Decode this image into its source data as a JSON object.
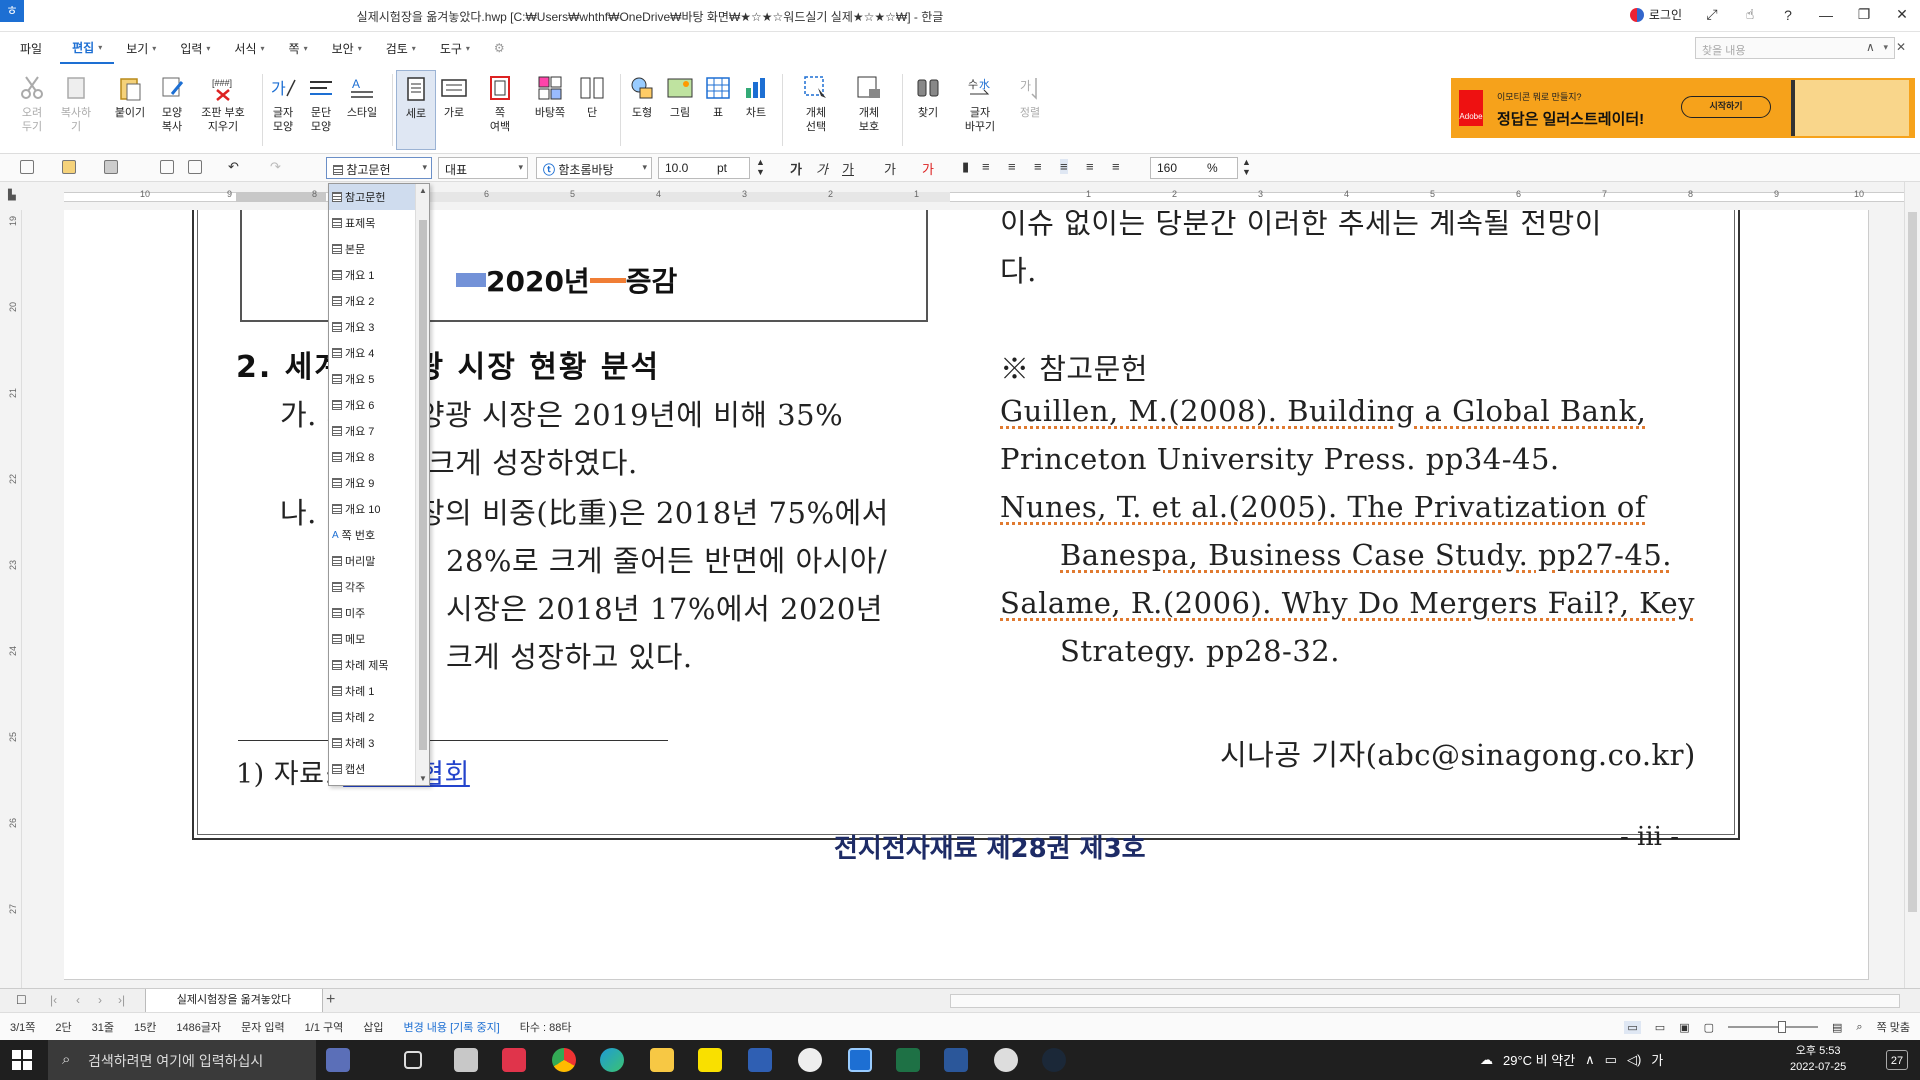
{
  "window": {
    "title": "실제시험장을 옮겨놓았다.hwp [C:₩Users₩whthf₩OneDrive₩바탕 화면₩★☆★☆워드실기 실제★☆★☆₩] - 한글",
    "login_label": "로그인"
  },
  "menu": {
    "items": [
      "파일",
      "편집",
      "보기",
      "입력",
      "서식",
      "쪽",
      "보안",
      "검토",
      "도구"
    ],
    "active": "편집",
    "search_placeholder": "찾을 내용"
  },
  "ribbon": {
    "buttons": [
      {
        "label": "오려\n두기",
        "icon": "scissors-icon"
      },
      {
        "label": "복사하기",
        "icon": "copy-icon"
      },
      {
        "label": "붙이기",
        "icon": "paste-icon"
      },
      {
        "label": "모양\n복사",
        "icon": "format-painter-icon"
      },
      {
        "label": "조판 부호\n지우기",
        "icon": "clear-codes-icon"
      },
      {
        "label": "글자\n모양",
        "icon": "char-shape-icon"
      },
      {
        "label": "문단\n모양",
        "icon": "para-shape-icon"
      },
      {
        "label": "스타일",
        "icon": "style-icon"
      },
      {
        "label": "세로",
        "icon": "portrait-icon"
      },
      {
        "label": "가로",
        "icon": "landscape-icon"
      },
      {
        "label": "쪽\n여백",
        "icon": "page-margin-icon"
      },
      {
        "label": "바탕쪽",
        "icon": "master-page-icon"
      },
      {
        "label": "단",
        "icon": "columns-icon"
      },
      {
        "label": "도형",
        "icon": "shape-icon"
      },
      {
        "label": "그림",
        "icon": "picture-icon"
      },
      {
        "label": "표",
        "icon": "table-icon"
      },
      {
        "label": "차트",
        "icon": "chart-icon"
      },
      {
        "label": "개체\n선택",
        "icon": "select-object-icon"
      },
      {
        "label": "개체\n보호",
        "icon": "protect-object-icon"
      },
      {
        "label": "찾기",
        "icon": "binoculars-icon"
      },
      {
        "label": "글자\n바꾸기",
        "icon": "char-convert-icon"
      },
      {
        "label": "정렬",
        "icon": "sort-icon"
      }
    ],
    "ad": {
      "brand": "Adobe",
      "small_text": "이모티콘 뭐로 만들지?",
      "headline": "정답은 일러스트레이터!",
      "button": "시작하기"
    }
  },
  "format_bar": {
    "style": "참고문헌",
    "font_lang": "대표",
    "font_name": "함초롬바탕",
    "font_size": "10.0",
    "font_unit": "pt",
    "line_spacing": "160",
    "line_unit": "%"
  },
  "style_dropdown": {
    "items": [
      "참고문헌",
      "표제목",
      "본문",
      "개요 1",
      "개요 2",
      "개요 3",
      "개요 4",
      "개요 5",
      "개요 6",
      "개요 7",
      "개요 8",
      "개요 9",
      "개요 10",
      "쪽 번호",
      "머리말",
      "각주",
      "미주",
      "메모",
      "차례 제목",
      "차례 1",
      "차례 2",
      "차례 3",
      "캡션"
    ],
    "selected_index": 0
  },
  "ruler": {
    "top_numbers": [
      "10",
      "9",
      "8",
      "7",
      "6",
      "5",
      "4",
      "3",
      "2",
      "1",
      "1",
      "2",
      "3",
      "4",
      "5",
      "6",
      "7",
      "8",
      "9",
      "10"
    ],
    "left_numbers": [
      "19",
      "20",
      "21",
      "22",
      "23",
      "24",
      "25",
      "26",
      "27"
    ]
  },
  "document": {
    "chart_legend": {
      "series_1": "2020년",
      "series_2": "증감"
    },
    "left_column": {
      "heading": "2. 세계 태양광 시장 현황 분석",
      "lines": [
        "가. 세계 태양광 시장은 2019년에 비해 35%",
        "크게 성장하였다.",
        "나. 유럽 시장의 비중(比重)은 2018년 75%에서",
        "28%로 크게 줄어든 반면에 아시아/",
        "시장은 2018년 17%에서 2020년",
        "크게 성장하고 있다."
      ],
      "footnote_prefix": "1) 자료: ",
      "footnote_link": "태양광협회"
    },
    "right_column": {
      "lines": [
        "이슈 없이는 당분간 이러한 추세는 계속될 전망이",
        "다.",
        "※ 참고문헌",
        "Guillen, M.(2008). Building a Global Bank,",
        "Princeton University Press. pp34-45.",
        "Nunes, T. et al.(2005). The Privatization of",
        "Banespa, Business Case Study. pp27-45.",
        "Salame, R.(2006). Why Do Mergers Fail?, Key",
        "Strategy. pp28-32.",
        "시나공 기자(abc@sinagong.co.kr)"
      ]
    },
    "footer_title": "전지전자재료 제28권 제3호",
    "page_number": "- iii -"
  },
  "tabs": {
    "active": "실제시험장을 옮겨놓았다"
  },
  "status": {
    "items": [
      "3/1쪽",
      "2단",
      "31줄",
      "15칸",
      "1486글자",
      "문자 입력",
      "1/1 구역",
      "삽입",
      "변경 내용 [기록 중지]",
      "타수 : 88타"
    ],
    "zoom_label": "쪽 맞춤"
  },
  "taskbar": {
    "search_placeholder": "검색하려면 여기에 입력하십시",
    "weather": "29°C 비 약간",
    "time": "오후 5:53",
    "date": "2022-07-25",
    "notifications": "27"
  }
}
